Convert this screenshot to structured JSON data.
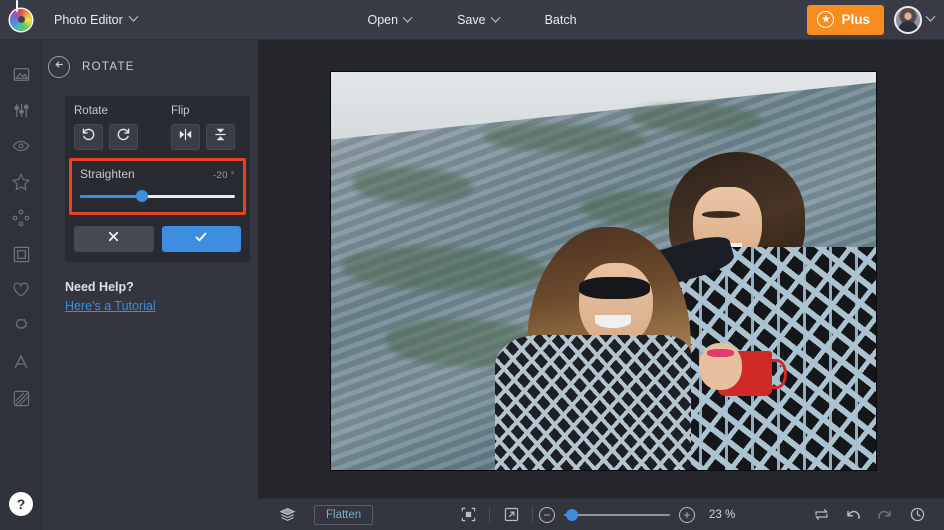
{
  "app": {
    "name": "Photo Editor",
    "logo_icon": "befunky-color-wheel-logo"
  },
  "topbar": {
    "title_label": "Photo Editor",
    "title_caret_icon": "chevron-down-icon",
    "open_label": "Open",
    "open_caret_icon": "chevron-down-icon",
    "save_label": "Save",
    "save_caret_icon": "chevron-down-icon",
    "batch_label": "Batch",
    "plus_label": "Plus",
    "plus_icon": "star-badge-icon",
    "plus_color": "#f68d1e",
    "avatar_icon": "user-avatar",
    "avatar_caret_icon": "chevron-down-icon"
  },
  "rail": {
    "items": [
      {
        "name": "photo-icon",
        "tooltip": "Edit"
      },
      {
        "name": "sliders-icon",
        "tooltip": "Exposure"
      },
      {
        "name": "eye-icon",
        "tooltip": "Retouch"
      },
      {
        "name": "star-icon",
        "tooltip": "Effects"
      },
      {
        "name": "nodes-icon",
        "tooltip": "Artsy"
      },
      {
        "name": "frame-icon",
        "tooltip": "Frames"
      },
      {
        "name": "heart-icon",
        "tooltip": "Overlays"
      },
      {
        "name": "badge-icon",
        "tooltip": "Graphics"
      },
      {
        "name": "letter-a-icon",
        "tooltip": "Text"
      },
      {
        "name": "texture-icon",
        "tooltip": "Textures"
      }
    ],
    "help_label": "?"
  },
  "panel": {
    "back_icon": "arrow-left-circle-icon",
    "title": "ROTATE",
    "rotate_group_label": "Rotate",
    "flip_group_label": "Flip",
    "rotate_left_icon": "rotate-counterclockwise-icon",
    "rotate_right_icon": "rotate-clockwise-icon",
    "flip_horizontal_icon": "flip-horizontal-icon",
    "flip_vertical_icon": "flip-vertical-icon",
    "straighten_label": "Straighten",
    "straighten_value": "-20 °",
    "straighten_percent": 40,
    "highlight_color": "#e8431f",
    "accent_color": "#3d8de0",
    "cancel_icon": "close-icon",
    "apply_icon": "check-icon",
    "need_help_label": "Need Help?",
    "tutorial_link_label": "Here's a Tutorial"
  },
  "canvas": {
    "image_alt": "Two women smiling outdoors in front of a rocky cliff, one holding a red mug"
  },
  "bottombar": {
    "layers_icon": "layers-icon",
    "flatten_label": "Flatten",
    "fit_icon": "fit-to-screen-icon",
    "fullscreen_icon": "expand-arrow-icon",
    "zoom_out_icon": "minus-icon",
    "zoom_in_icon": "plus-icon",
    "zoom_percent_label": "23 %",
    "zoom_slider_percent": 8,
    "compare_icon": "compare-swap-icon",
    "undo_icon": "undo-arrow-icon",
    "redo_icon": "redo-arrow-icon",
    "history_icon": "history-clock-icon"
  }
}
